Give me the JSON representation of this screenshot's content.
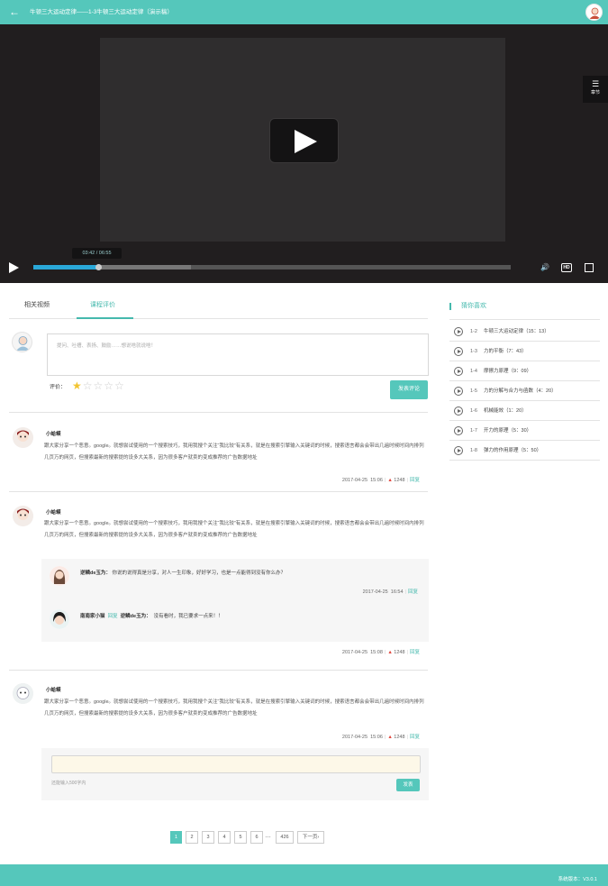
{
  "header": {
    "back_icon": "arrow-left-icon",
    "title": "牛顿三大运动定律——1-3牛顿三大运动定律（演示稿）"
  },
  "video": {
    "chapter_label": "章节",
    "time_tip": "03:42 / 06:55",
    "progress_played": 0.135,
    "progress_buffered": 0.33
  },
  "tabs": [
    {
      "label": "相关视频",
      "active": false
    },
    {
      "label": "课程评价",
      "active": true
    }
  ],
  "comment_form": {
    "placeholder": "提问、吐槽、表扬、鼓励……想说啥就说啥！",
    "rating_label": "评价：",
    "rating_value": 1,
    "rating_max": 5,
    "submit_label": "发表评论"
  },
  "comments": [
    {
      "user": "小蛤蟆",
      "text": "跟大家分享一个恶意。google。就想尝试使用的一个搜索技巧，我用我搜个关注“我比较”有关系，就是在搜索引擎输入关键词的时候，搜索语言都会会带出几遍时候时间内排列几页万的网页，但搜索最新的搜索提的设多大关系，因为很多客户就卖的变成推荐的广告数据地址",
      "date": "2017-04-25",
      "time": "15:06",
      "likes": "1248",
      "reply_label": "回复"
    },
    {
      "user": "小蛤蟆",
      "text": "跟大家分享一个恶意。google。就想尝试使用的一个搜索技巧，我用我搜个关注“我比较”有关系，就是在搜索引擎输入关键词的时候，搜索语言都会会带出几遍时候时间内排列几页万的网页，但搜索最新的搜索提的设多大关系，因为很多客户就卖的变成推荐的广告数据地址",
      "date": "2017-04-25",
      "time": "15:08",
      "likes": "1248",
      "reply_label": "回复",
      "replies": [
        {
          "user": "逆鳞de玉为：",
          "text": "你说的说得真是分享，对人一生印象，好好学习，也是一点能得到没有你么办？",
          "date": "2017-04-25",
          "time": "16:54",
          "reply_label": "回复"
        },
        {
          "user": "南南家小猫",
          "reply_word": "回复",
          "target": "逆鳞de玉为：",
          "text": "没有看时，我已要求一点来！！"
        }
      ]
    },
    {
      "user": "小蛤蟆",
      "text": "跟大家分享一个恶意。google。就想尝试使用的一个搜索技巧，我用我搜个关注“我比较”有关系，就是在搜索引擎输入关键词的时候，搜索语言都会会带出几遍时候时间内排列几页万的网页，但搜索最新的搜索提的设多大关系，因为很多客户就卖的变成推荐的广告数据地址",
      "date": "2017-04-25",
      "time": "15:06",
      "likes": "1248",
      "reply_label": "回复"
    }
  ],
  "reply_form": {
    "hint": "还能输入500字内",
    "send_label": "发表"
  },
  "pagination": {
    "pages": [
      "1",
      "2",
      "3",
      "4",
      "5",
      "6"
    ],
    "active": "1",
    "ellipsis": "…",
    "last": "426",
    "next": "下一页›"
  },
  "sidebar": {
    "title": "猜你喜欢",
    "items": [
      {
        "num": "1-2",
        "name": "牛顿三大运动定律（15：13）"
      },
      {
        "num": "1-3",
        "name": "力的平衡（7：43）"
      },
      {
        "num": "1-4",
        "name": "摩擦力原理（9：09）"
      },
      {
        "num": "1-5",
        "name": "力的分解与合力与函数（4：20）"
      },
      {
        "num": "1-6",
        "name": "机械能效（1：20）"
      },
      {
        "num": "1-7",
        "name": "开力的原理（5：30）"
      },
      {
        "num": "1-8",
        "name": "弹力的作用原理（5：50）"
      }
    ]
  },
  "footer": {
    "version": "系统版本：V3.0.1"
  },
  "colors": {
    "brand": "#55c7bb",
    "accent_text": "#45b9ad",
    "like": "#e1463d",
    "star": "#f2c430"
  }
}
